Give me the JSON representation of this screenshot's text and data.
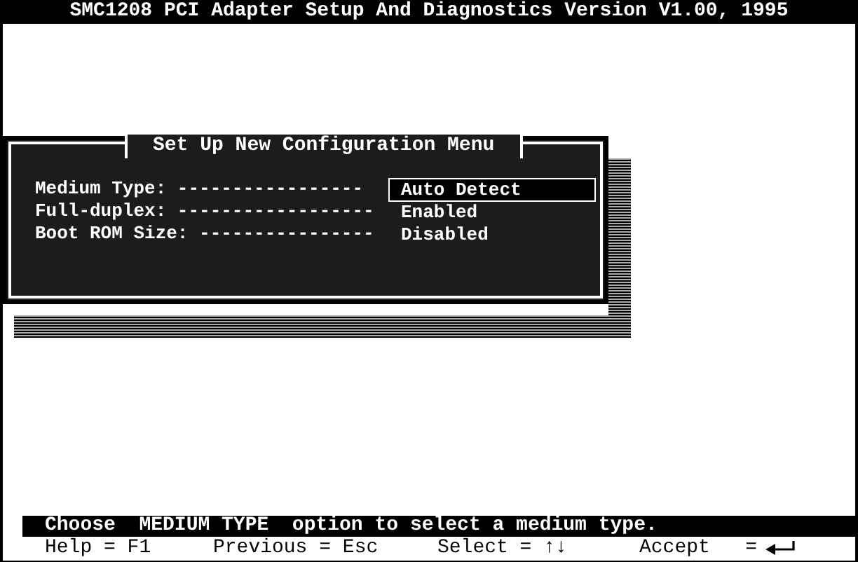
{
  "window": {
    "title": "SMC1208 PCI Adapter Setup And Diagnostics Version V1.00, 1995"
  },
  "dialog": {
    "title": "Set Up New Configuration Menu",
    "options": [
      {
        "label": "Medium Type:",
        "leader": "-----------------",
        "value": "Auto Detect",
        "selected": true
      },
      {
        "label": "Full-duplex:",
        "leader": "------------------",
        "value": "Enabled",
        "selected": false
      },
      {
        "label": "Boot ROM Size:",
        "leader": "----------------",
        "value": "Disabled",
        "selected": false
      }
    ]
  },
  "status_bar": {
    "message": "Choose  MEDIUM TYPE  option to select a medium type."
  },
  "key_hints": [
    {
      "kind": "text",
      "text": "Help = F1"
    },
    {
      "kind": "text",
      "text": "Previous = Esc"
    },
    {
      "kind": "text",
      "text": "Select = ↑↓"
    },
    {
      "kind": "enter",
      "text": "Accept   ="
    }
  ]
}
